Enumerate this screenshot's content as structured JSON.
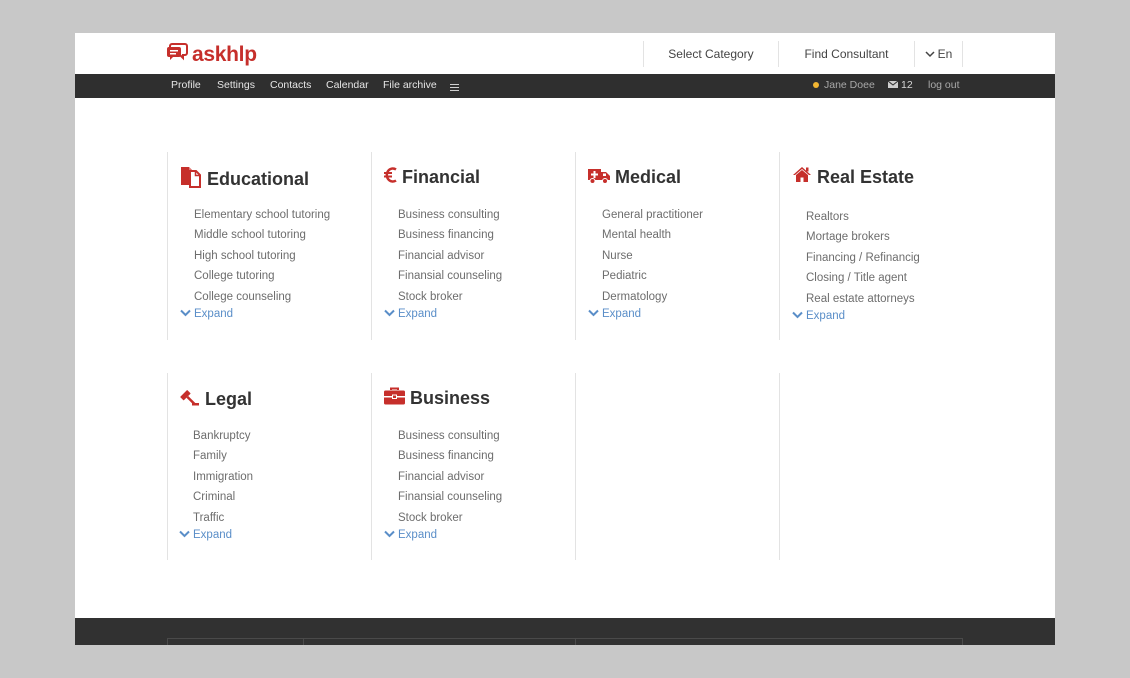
{
  "brand": {
    "name": "askhlp",
    "color": "#c62f2b"
  },
  "header": {
    "select_category": "Select Category",
    "find_consultant": "Find Consultant",
    "language": "En"
  },
  "topbar": {
    "nav": [
      "Profile",
      "Settings",
      "Contacts",
      "Calendar",
      "File archive"
    ],
    "user_name": "Jane Doee",
    "messages_count": "12",
    "logout": "log out"
  },
  "categories": [
    {
      "title": "Educational",
      "icon": "document-icon",
      "items": [
        "Elementary school tutoring",
        "Middle school tutoring",
        "High school tutoring",
        "College tutoring",
        "College counseling"
      ],
      "expand": "Expand"
    },
    {
      "title": "Financial",
      "icon": "euro-icon",
      "items": [
        "Business consulting",
        "Business financing",
        "Financial advisor",
        "Finansial counseling",
        "Stock broker"
      ],
      "expand": "Expand"
    },
    {
      "title": "Medical",
      "icon": "ambulance-icon",
      "items": [
        "General practitioner",
        "Mental health",
        "Nurse",
        "Pediatric",
        "Dermatology"
      ],
      "expand": "Expand"
    },
    {
      "title": "Real Estate",
      "icon": "house-icon",
      "items": [
        "Realtors",
        "Mortage brokers",
        "Financing / Refinancig",
        "Closing / Title agent",
        "Real estate attorneys"
      ],
      "expand": "Expand"
    },
    {
      "title": "Legal",
      "icon": "gavel-icon",
      "items": [
        "Bankruptcy",
        "Family",
        "Immigration",
        "Criminal",
        "Traffic"
      ],
      "expand": "Expand"
    },
    {
      "title": "Business",
      "icon": "briefcase-icon",
      "items": [
        "Business consulting",
        "Business financing",
        "Financial advisor",
        "Finansial counseling",
        "Stock broker"
      ],
      "expand": "Expand"
    }
  ]
}
